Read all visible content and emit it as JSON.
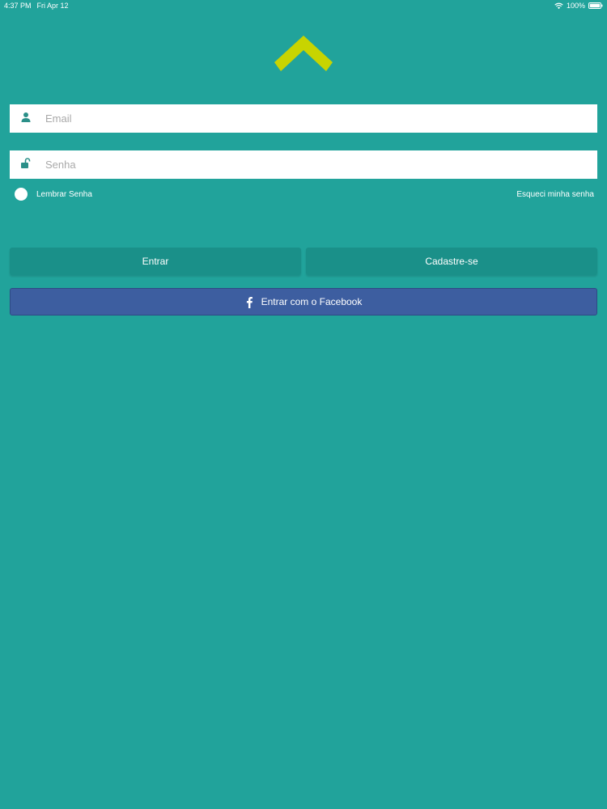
{
  "status_bar": {
    "time": "4:37 PM",
    "date": "Fri Apr 12",
    "battery": "100%",
    "wifi_icon": "wifi-icon",
    "battery_icon": "battery-icon"
  },
  "colors": {
    "background": "#21a39b",
    "logo": "#c8d400",
    "button": "#1a9089",
    "facebook": "#3d5ea0"
  },
  "logo": {
    "icon": "chevron-up-logo-icon"
  },
  "login_form": {
    "email": {
      "placeholder": "Email",
      "value": "",
      "icon": "user-icon"
    },
    "password": {
      "placeholder": "Senha",
      "value": "",
      "icon": "lock-icon"
    },
    "remember_label": "Lembrar Senha",
    "forgot_link": "Esqueci minha senha"
  },
  "actions": {
    "login_label": "Entrar",
    "register_label": "Cadastre-se",
    "facebook_label": "Entrar com o Facebook",
    "facebook_icon": "facebook-icon"
  }
}
